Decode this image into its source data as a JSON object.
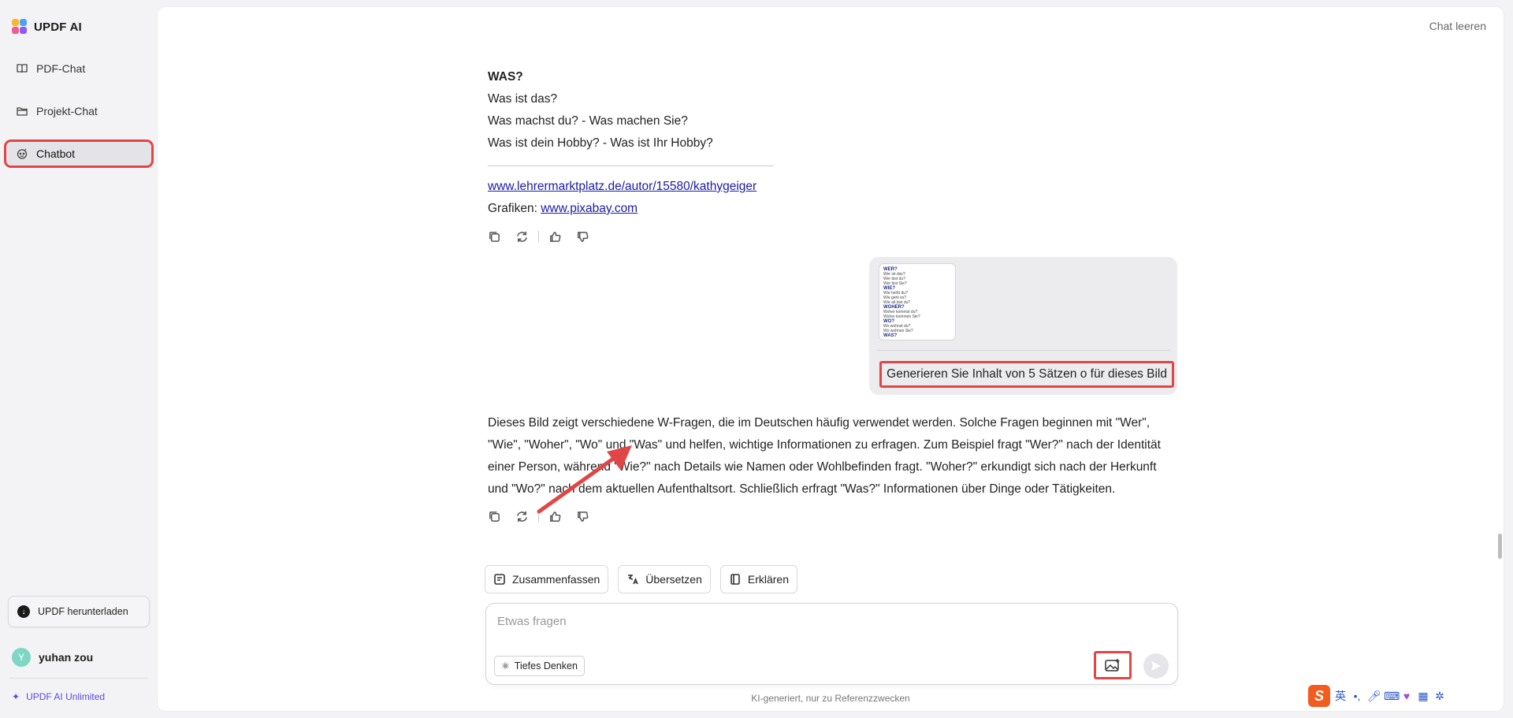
{
  "app": {
    "name": "UPDF AI"
  },
  "sidebar": {
    "items": [
      {
        "label": "PDF-Chat",
        "icon": "book-icon"
      },
      {
        "label": "Projekt-Chat",
        "icon": "folder-icon"
      },
      {
        "label": "Chatbot",
        "icon": "bot-icon"
      }
    ],
    "active": "Chatbot",
    "download_label": "UPDF herunterladen",
    "user": {
      "initial": "Y",
      "name": "yuhan zou"
    },
    "plan_label": "UPDF AI Unlimited"
  },
  "header": {
    "clear_chat": "Chat leeren"
  },
  "messages": {
    "first": {
      "heading": "WAS?",
      "lines": [
        "Was ist das?",
        "Was machst du? - Was machen Sie?",
        "Was ist dein Hobby? - Was ist Ihr Hobby?"
      ],
      "link1": "www.lehrermarktplatz.de/autor/15580/kathygeiger",
      "credits_prefix": "Grafiken: ",
      "link2": "www.pixabay.com"
    },
    "user": {
      "text": "Generieren Sie Inhalt von 5 Sätzen o für dieses Bild",
      "thumbnail_lines": [
        "WER?",
        "WIE?",
        "WOHER?",
        "WO?",
        "WAS?"
      ]
    },
    "answer": {
      "text": "Dieses Bild zeigt verschiedene W-Fragen, die im Deutschen häufig verwendet werden. Solche Fragen beginnen mit \"Wer\", \"Wie\", \"Woher\", \"Wo\" und \"Was\" und helfen, wichtige Informationen zu erfragen. Zum Beispiel fragt \"Wer?\" nach der Identität einer Person, während \"Wie?\" nach Details wie Namen oder Wohlbefinden fragt. \"Woher?\" erkundigt sich nach der Herkunft und \"Wo?\" nach dem aktuellen Aufenthaltsort. Schließlich erfragt \"Was?\" Informationen über Dinge oder Tätigkeiten."
    }
  },
  "quick_actions": [
    {
      "label": "Zusammenfassen",
      "icon": "summarize-icon"
    },
    {
      "label": "Übersetzen",
      "icon": "translate-icon"
    },
    {
      "label": "Erklären",
      "icon": "explain-icon"
    }
  ],
  "composer": {
    "placeholder": "Etwas fragen",
    "deep_think_label": "Tiefes Denken"
  },
  "footnote": "KI-generiert, nur zu Referenzzwecken",
  "ime": {
    "lang": "英"
  },
  "colors": {
    "highlight": "#e04646",
    "accent": "#5b4be0",
    "link": "#1a1aa8"
  }
}
